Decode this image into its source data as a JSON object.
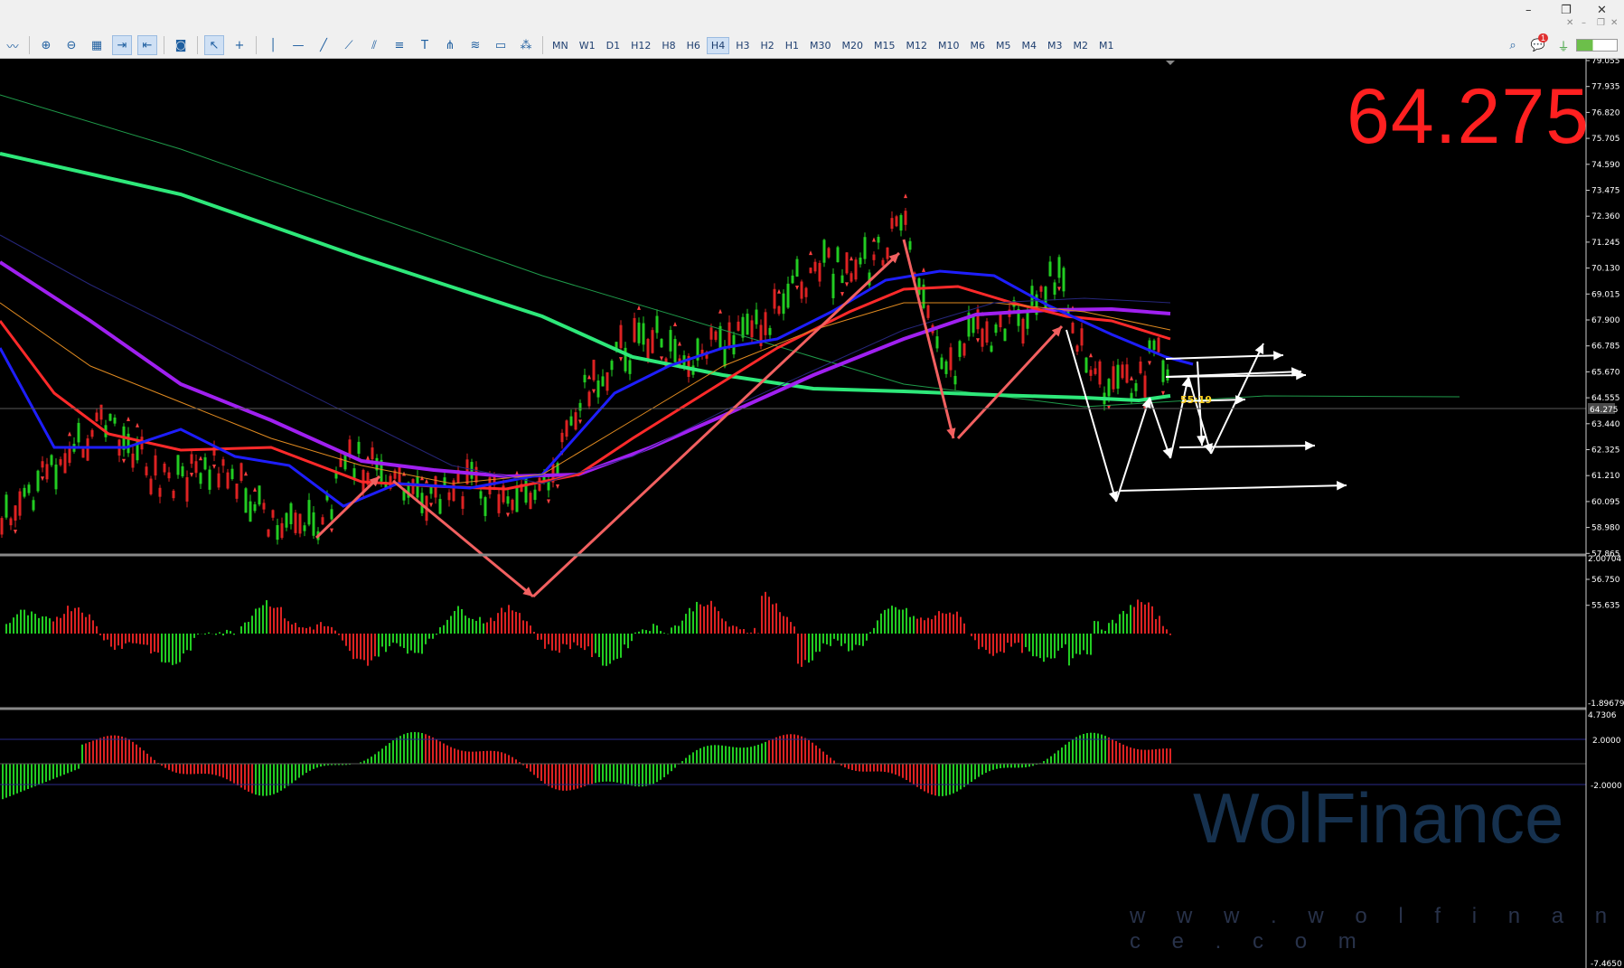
{
  "window": {
    "controls": [
      "–",
      "❐",
      "✕"
    ],
    "sub_controls": [
      "✕",
      "–",
      "❐",
      "✕"
    ]
  },
  "toolbar": {
    "tool_icons": [
      "chart-type-icon",
      "zoom-in-icon",
      "zoom-out-icon",
      "grid-icon",
      "autoscroll-icon",
      "chart-shift-icon",
      "screenshot-icon",
      "cursor-icon",
      "crosshair-icon",
      "vertical-line-icon",
      "horizontal-line-icon",
      "trendline-icon",
      "ray-icon",
      "channel-icon",
      "fibonacci-icon",
      "text-icon",
      "pitchfork-icon",
      "gann-icon",
      "rectangle-icon",
      "shapes-icon"
    ],
    "timeframes": [
      "MN",
      "W1",
      "D1",
      "H12",
      "H8",
      "H6",
      "H4",
      "H3",
      "H2",
      "H1",
      "M30",
      "M20",
      "M15",
      "M12",
      "M10",
      "M6",
      "M5",
      "M4",
      "M3",
      "M2",
      "M1"
    ],
    "active_timeframe": "H4",
    "notification_count": "1"
  },
  "price_display": "64.275",
  "candle_timer": "55:19",
  "price_axis": {
    "labels": [
      "79.055",
      "77.935",
      "76.820",
      "75.705",
      "74.590",
      "73.475",
      "72.360",
      "71.245",
      "70.130",
      "69.015",
      "67.900",
      "66.785",
      "65.670",
      "64.555",
      "63.440",
      "62.325",
      "61.210",
      "60.095",
      "58.980",
      "57.865",
      "56.750",
      "55.635"
    ],
    "current": "64.275"
  },
  "macd_axis": {
    "top": "2.00704",
    "bottom": "-1.89679"
  },
  "osc_axis": {
    "labels": [
      "4.7306",
      "2.0000",
      "-2.0000",
      "-7.4650"
    ]
  },
  "watermark": {
    "logo_text": "WolFinance",
    "url": "w w w . w o l f i n a n c e . c o m"
  },
  "colors": {
    "ma_green": "#2ee87a",
    "ma_red": "#ff2a2a",
    "ma_purple": "#a020f0",
    "ma_blue": "#1e1eff",
    "arrow_red": "#f26060",
    "arrow_white": "#ffffff",
    "bull": "#22cc22",
    "bear": "#dd2222"
  }
}
